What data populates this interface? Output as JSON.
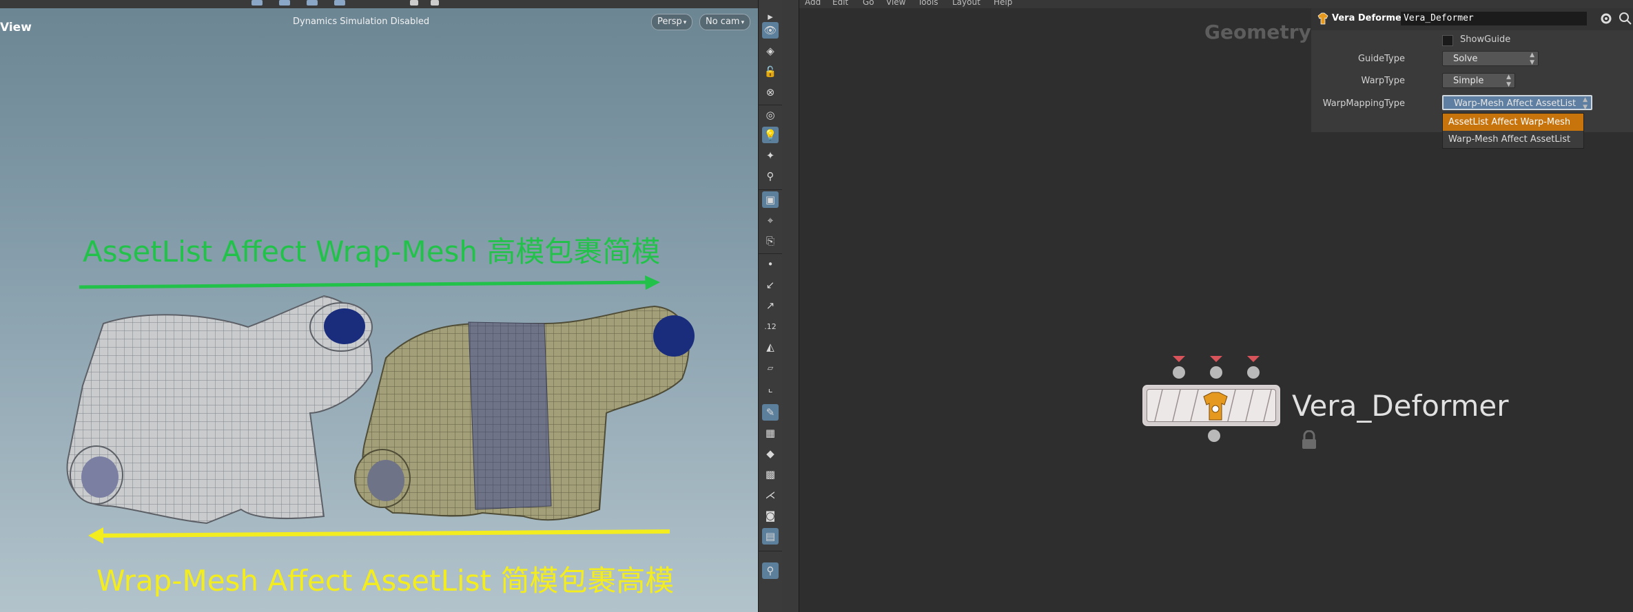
{
  "viewport": {
    "title": "View",
    "simulation_status": "Dynamics Simulation Disabled",
    "camera_mode": "Persp",
    "camera": "No cam",
    "annotation_top": "AssetList Affect Wrap-Mesh  高模包裹简模",
    "annotation_bottom": "Wrap-Mesh Affect AssetList 简模包裹高模",
    "colors": {
      "annotation_top": "#22c24a",
      "annotation_bottom": "#f3ec1f"
    }
  },
  "network": {
    "context_label": "Geometry",
    "menu": [
      "Add",
      "Edit",
      "Go",
      "View",
      "Tools",
      "Layout",
      "Help"
    ],
    "node": {
      "name": "Vera_Deformer"
    }
  },
  "parameters": {
    "node_type": "Vera Deformer",
    "node_name": "Vera_Deformer",
    "show_guide_label": "ShowGuide",
    "guide_type": {
      "label": "GuideType",
      "value": "Solve"
    },
    "warp_type": {
      "label": "WarpType",
      "value": "Simple"
    },
    "warp_mapping_type": {
      "label": "WarpMappingType",
      "value": "Warp-Mesh Affect AssetList",
      "options": [
        "AssetList Affect Warp-Mesh",
        "Warp-Mesh Affect AssetList"
      ]
    },
    "colors": {
      "highlight": "#c8740d"
    }
  }
}
